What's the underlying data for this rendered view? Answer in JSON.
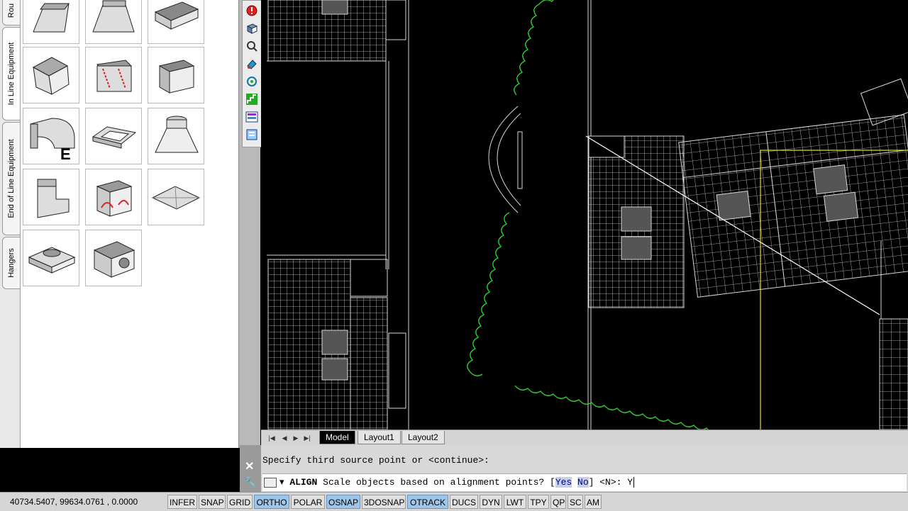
{
  "palette": {
    "tabs": [
      "Rou",
      "In Line Equipment",
      "End of Line Equipment",
      "Hangers"
    ],
    "tools": [
      "duct-transition",
      "duct-reducer",
      "duct-straight",
      "duct-offset",
      "duct-damper",
      "duct-box",
      "duct-elbow-e",
      "duct-collar",
      "duct-hood",
      "duct-boot",
      "duct-fitting-red",
      "flat-plate",
      "round-takeoff",
      "plenum-box"
    ]
  },
  "side_toolbar": {
    "icons": [
      "info-icon",
      "3d-box-icon",
      "zoom-icon",
      "paint-icon",
      "orbit-icon",
      "stairs-icon",
      "layer-icon",
      "properties-icon"
    ]
  },
  "layout_tabs": {
    "tabs": [
      "Model",
      "Layout1",
      "Layout2"
    ],
    "active": "Model"
  },
  "command": {
    "history": "Specify third source point or <continue>:",
    "prompt_command": "ALIGN",
    "prompt_text": "Scale objects based on alignment points? [",
    "option_yes": "Yes",
    "option_no": "No",
    "prompt_tail": "] <N>:",
    "input": "Y"
  },
  "status": {
    "coords": "40734.5407, 99634.0761 , 0.0000",
    "buttons": [
      {
        "label": "INFER",
        "on": false
      },
      {
        "label": "SNAP",
        "on": false
      },
      {
        "label": "GRID",
        "on": false
      },
      {
        "label": "ORTHO",
        "on": true
      },
      {
        "label": "POLAR",
        "on": false
      },
      {
        "label": "OSNAP",
        "on": true
      },
      {
        "label": "3DOSNAP",
        "on": false
      },
      {
        "label": "OTRACK",
        "on": true
      },
      {
        "label": "DUCS",
        "on": false
      },
      {
        "label": "DYN",
        "on": false
      },
      {
        "label": "LWT",
        "on": false
      },
      {
        "label": "TPY",
        "on": false
      },
      {
        "label": "QP",
        "on": false
      },
      {
        "label": "SC",
        "on": false
      },
      {
        "label": "AM",
        "on": false
      }
    ]
  },
  "colors": {
    "canvas": "#000000",
    "cloud": "#33cc33",
    "geometry": "#d8d8d8",
    "crosshair": "#e0e020"
  }
}
